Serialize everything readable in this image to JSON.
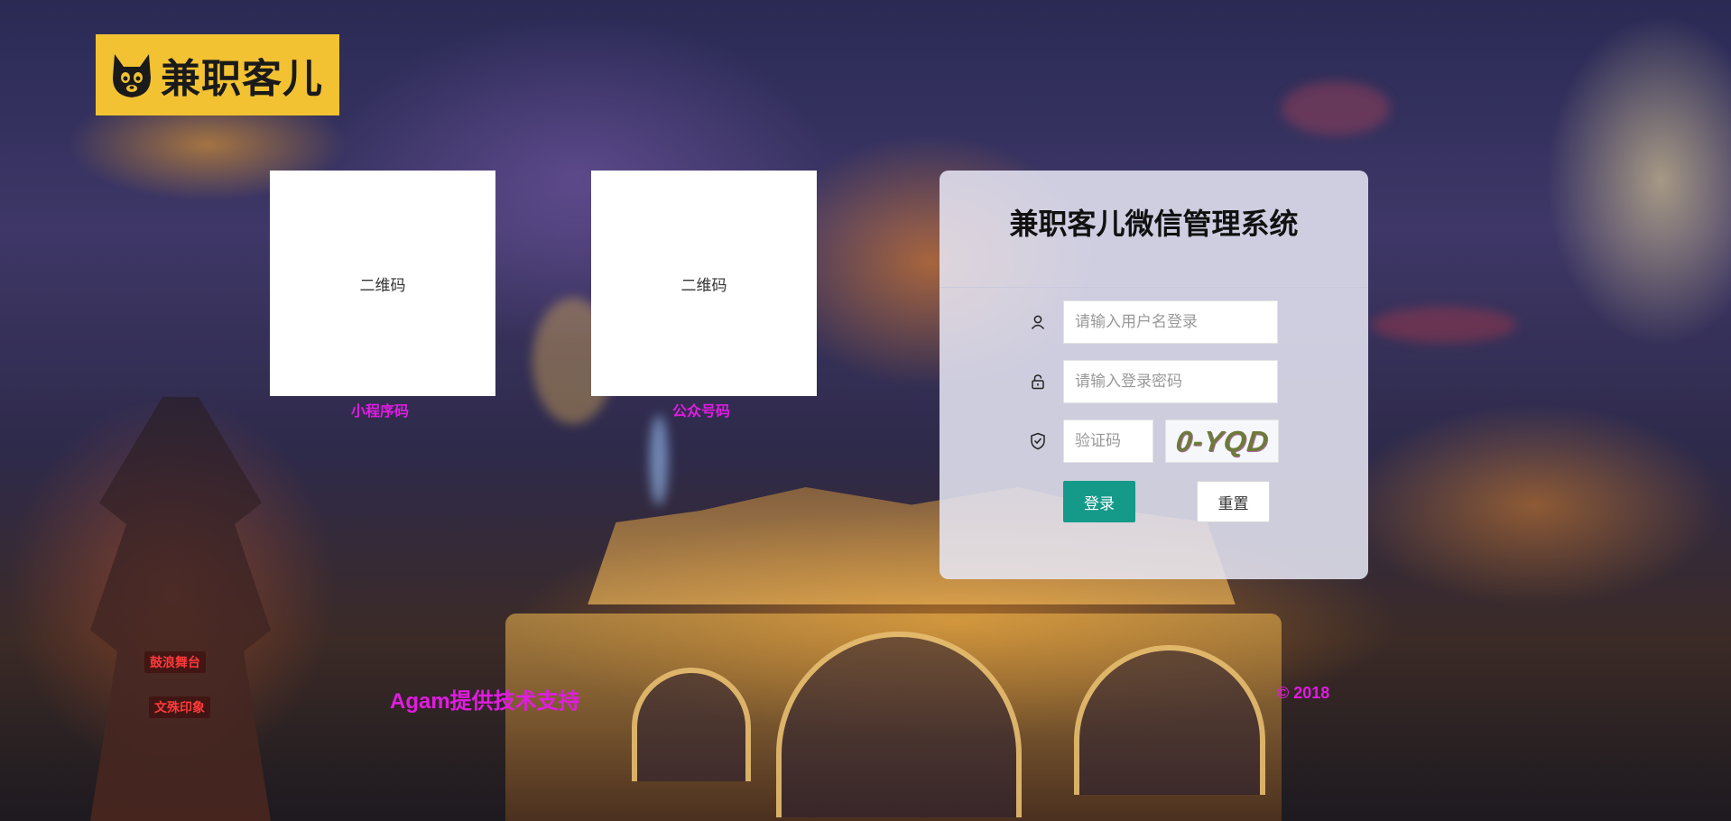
{
  "brand": {
    "logo_text": "兼职客儿",
    "logo_bg": "#f2c232",
    "logo_icon": "dog-face-icon"
  },
  "qr_codes": [
    {
      "placeholder": "二维码",
      "caption": "小程序码"
    },
    {
      "placeholder": "二维码",
      "caption": "公众号码"
    }
  ],
  "login": {
    "title": "兼职客儿微信管理系统",
    "username_placeholder": "请输入用户名登录",
    "password_placeholder": "请输入登录密码",
    "captcha_placeholder": "验证码",
    "captcha_text": "0-YQD",
    "login_label": "登录",
    "reset_label": "重置",
    "icons": {
      "user": "user-icon",
      "password": "lock-icon",
      "captcha": "shield-check-icon"
    }
  },
  "background_signs": [
    "鼓浪舞台",
    "文殊印象"
  ],
  "footer": {
    "support_text": "Agam提供技术支持",
    "copyright": "© 2018"
  },
  "colors": {
    "accent": "#159a8a",
    "caption_magenta": "#e01ce0",
    "panel_bg": "rgba(232,232,246,0.86)"
  }
}
